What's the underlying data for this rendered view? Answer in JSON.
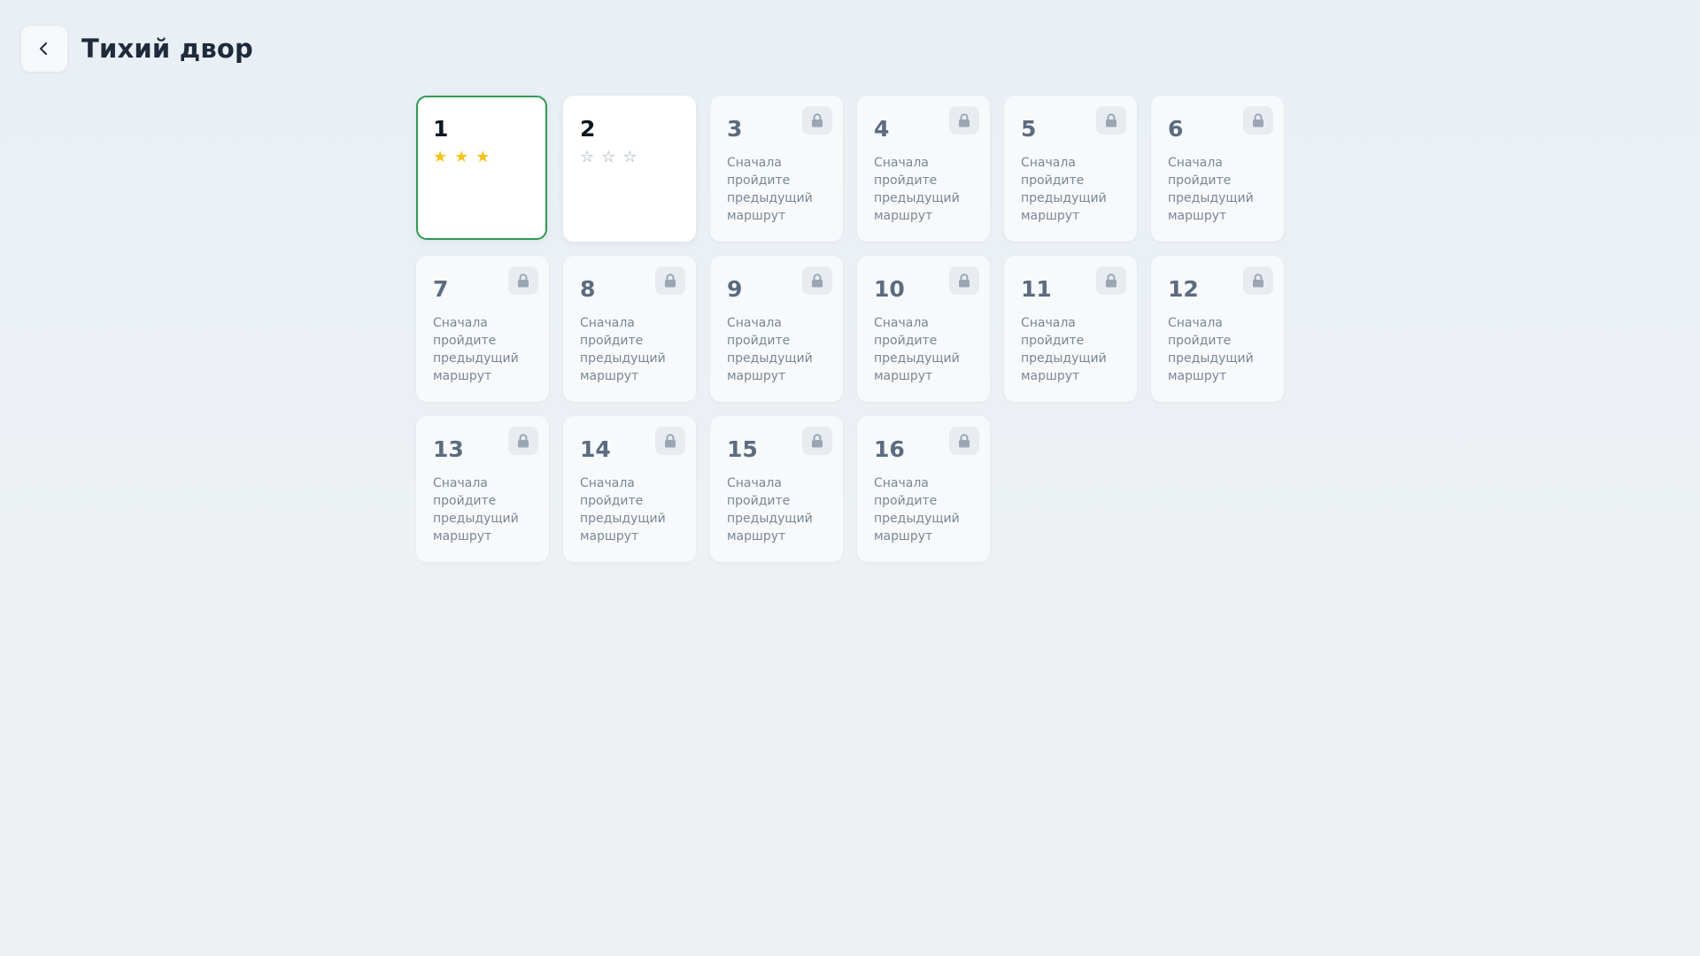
{
  "header": {
    "title": "Тихий двор",
    "back_icon": "chevron-left-icon"
  },
  "colors": {
    "selected_border": "#2c9b52",
    "star_filled": "#f3c21b",
    "star_empty": "#9aa6b4",
    "lock_icon": "#9aa6b4"
  },
  "levels": [
    {
      "number": "1",
      "status": "completed",
      "stars_earned": 3,
      "stars_total": 3,
      "selected": true
    },
    {
      "number": "2",
      "status": "unlocked",
      "stars_earned": 0,
      "stars_total": 3,
      "selected": false
    },
    {
      "number": "3",
      "status": "locked",
      "message": "Сначала пройдите предыдущий маршрут",
      "icon": "lock-icon"
    },
    {
      "number": "4",
      "status": "locked",
      "message": "Сначала пройдите предыдущий маршрут",
      "icon": "lock-icon"
    },
    {
      "number": "5",
      "status": "locked",
      "message": "Сначала пройдите предыдущий маршрут",
      "icon": "lock-icon"
    },
    {
      "number": "6",
      "status": "locked",
      "message": "Сначала пройдите предыдущий маршрут",
      "icon": "lock-icon"
    },
    {
      "number": "7",
      "status": "locked",
      "message": "Сначала пройдите предыдущий маршрут",
      "icon": "lock-icon"
    },
    {
      "number": "8",
      "status": "locked",
      "message": "Сначала пройдите предыдущий маршрут",
      "icon": "lock-icon"
    },
    {
      "number": "9",
      "status": "locked",
      "message": "Сначала пройдите предыдущий маршрут",
      "icon": "lock-icon"
    },
    {
      "number": "10",
      "status": "locked",
      "message": "Сначала пройдите предыдущий маршрут",
      "icon": "lock-icon"
    },
    {
      "number": "11",
      "status": "locked",
      "message": "Сначала пройдите предыдущий маршрут",
      "icon": "lock-icon"
    },
    {
      "number": "12",
      "status": "locked",
      "message": "Сначала пройдите предыдущий маршрут",
      "icon": "lock-icon"
    },
    {
      "number": "13",
      "status": "locked",
      "message": "Сначала пройдите предыдущий маршрут",
      "icon": "lock-icon"
    },
    {
      "number": "14",
      "status": "locked",
      "message": "Сначала пройдите предыдущий маршрут",
      "icon": "lock-icon"
    },
    {
      "number": "15",
      "status": "locked",
      "message": "Сначала пройдите предыдущий маршрут",
      "icon": "lock-icon"
    },
    {
      "number": "16",
      "status": "locked",
      "message": "Сначала пройдите предыдущий маршрут",
      "icon": "lock-icon"
    }
  ]
}
